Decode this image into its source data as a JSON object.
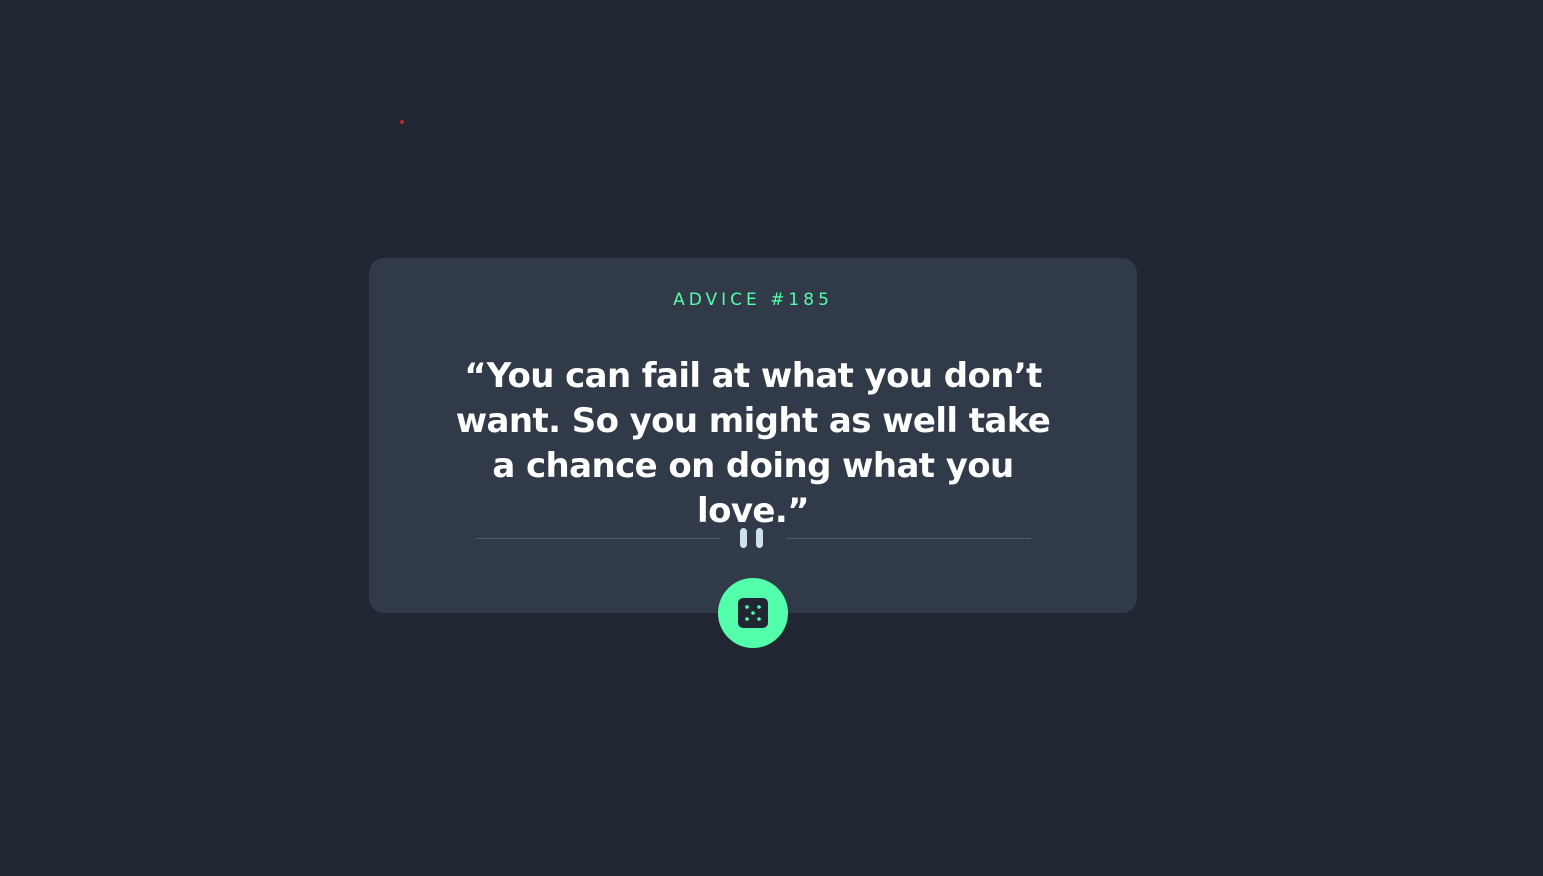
{
  "advice": {
    "label": "ADVICE #185",
    "quote": "“You can fail at what you don’t want. So you might as well take a chance on doing what you love.”"
  },
  "controls": {
    "divider_icon": "pause-icon",
    "generate_icon": "dice-icon"
  },
  "colors": {
    "background": "#202733",
    "card": "#313a48",
    "accent": "#53ffaa",
    "text": "#ffffff",
    "divider": "#4f5d74"
  }
}
